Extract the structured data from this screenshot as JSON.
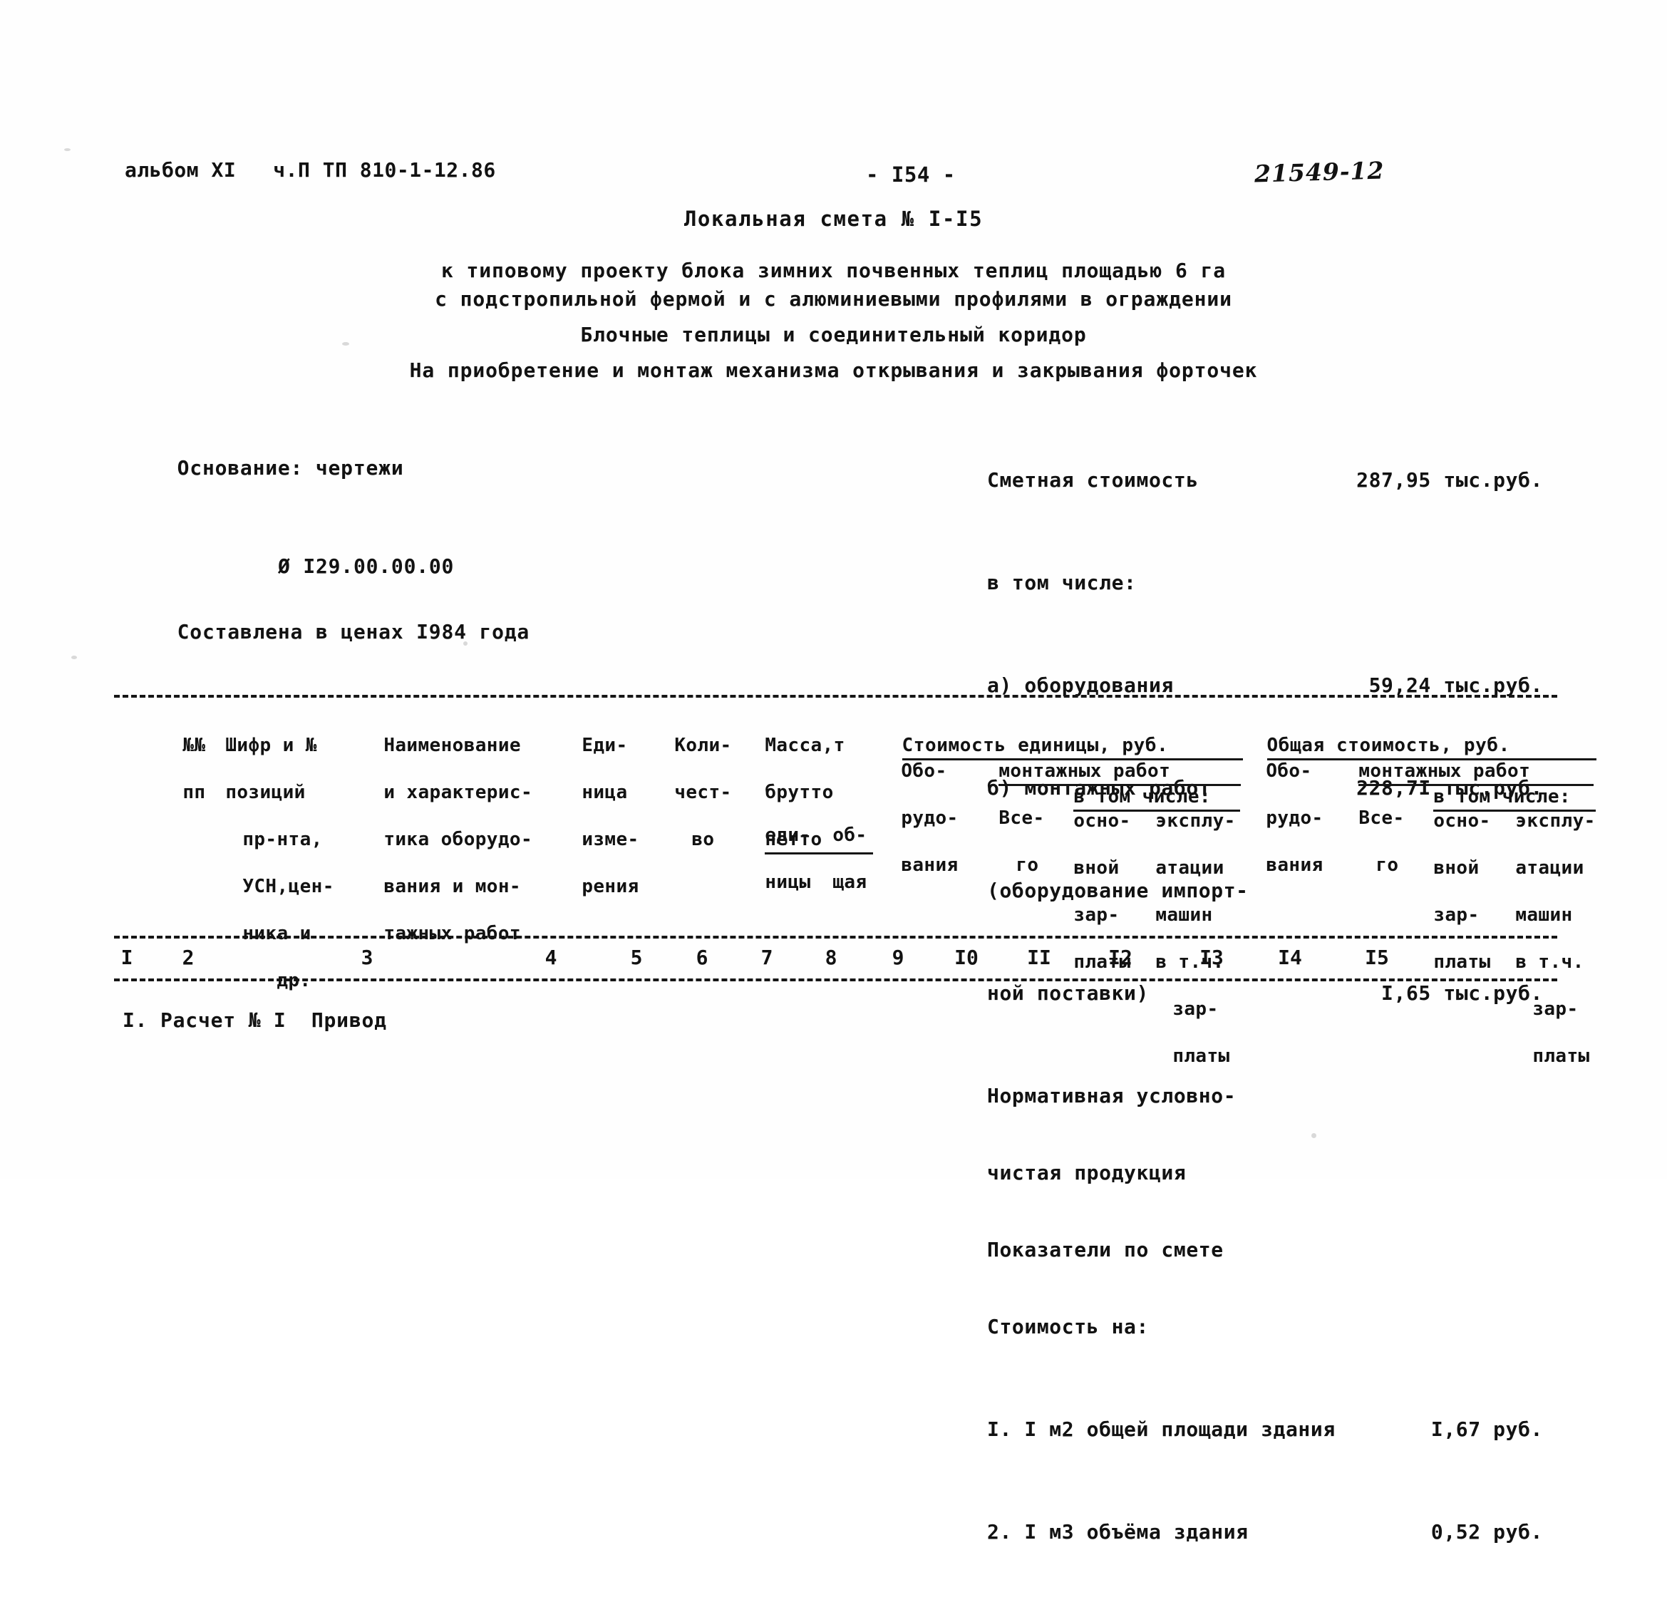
{
  "header": {
    "album": "альбом XI   ч.П ТП 810-1-12.86",
    "page_number": "- I54 -",
    "doc_code": "21549-12"
  },
  "title": {
    "main": "Локальная смета № I-I5",
    "line1": "к типовому проекту блока зимних почвенных теплиц площадью 6 га",
    "line2": "с подстропильной фермой и с алюминиевыми профилями в ограждении",
    "line3": "Блочные теплицы и соединительный коридор",
    "line4": "На приобретение и монтаж механизма открывания и закрывания форточек"
  },
  "basis": {
    "line1": "Основание: чертежи",
    "line2": "Ø I29.00.00.00",
    "line3": "Составлена в ценах I984 года"
  },
  "summary": {
    "total_label": "Сметная стоимость",
    "total_value": "287,95 тыс.руб.",
    "including_label": "в том числе:",
    "equipment_label": "а) оборудования",
    "equipment_value": "59,24 тыс.руб.",
    "installation_label": "б) монтажных работ",
    "installation_value": "228,7I тыс.руб.",
    "import_label1": "(оборудование импорт-",
    "import_label2": "ной поставки)",
    "import_value": "I,65 тыс.руб.",
    "nucp_line1": "Нормативная условно-",
    "nucp_line2": "чистая продукция",
    "indicators_label": "Показатели по смете",
    "cost_per_label": "Стоимость на:",
    "per_m2_label": "I. I м2 общей площади здания",
    "per_m2_value": "I,67 руб.",
    "per_m3_label": "2. I м3 объёма здания",
    "per_m3_value": "0,52 руб."
  },
  "table": {
    "columns": [
      {
        "num": "I",
        "lines": [
          "№№",
          "пп"
        ]
      },
      {
        "num": "2",
        "lines": [
          "Шифр и №",
          "позиций",
          "пр-нта,",
          "УСН,цен-",
          "ника и",
          "др."
        ]
      },
      {
        "num": "3",
        "lines": [
          "Наименование",
          "и характерис-",
          "тика оборудо-",
          "вания и мон-",
          "тажных работ"
        ]
      },
      {
        "num": "4",
        "lines": [
          "Еди-",
          "ница",
          "изме-",
          "рения"
        ]
      },
      {
        "num": "5",
        "lines": [
          "Коли-",
          "чест-",
          "во"
        ]
      },
      {
        "num": "6",
        "lines": [
          "еди-",
          "ницы"
        ]
      },
      {
        "num": "7",
        "lines": [
          "об-",
          "щая"
        ]
      },
      {
        "num": "8",
        "lines": [
          "Обо-",
          "рудо-",
          "вания"
        ]
      },
      {
        "num": "9",
        "lines": [
          "Все-",
          "го"
        ]
      },
      {
        "num": "I0",
        "lines": [
          "осно-",
          "вной",
          "зар-",
          "платы"
        ]
      },
      {
        "num": "II",
        "lines": [
          "эксплу-",
          "атации",
          "машин",
          "в т.ч.",
          "зар-",
          "платы"
        ]
      },
      {
        "num": "I2",
        "lines": [
          "Обо-",
          "рудо-",
          "вания"
        ]
      },
      {
        "num": "I3",
        "lines": [
          "Все-",
          "го"
        ]
      },
      {
        "num": "I4",
        "lines": [
          "осно-",
          "вной",
          "зар-",
          "платы"
        ]
      },
      {
        "num": "I5",
        "lines": [
          "эксплу-",
          "атации",
          "машин",
          "в т.ч.",
          "зар-",
          "платы"
        ]
      }
    ],
    "mass_group": {
      "title": "Масса,т",
      "brutto": "брутто",
      "netto": "нетто"
    },
    "unit_cost_group": {
      "title": "Стоимость единицы, руб.",
      "sub_installation": "монтажных работ",
      "sub_including": "в том числе:"
    },
    "total_cost_group": {
      "title": "Общая стоимость, руб.",
      "sub_installation": "монтажных работ",
      "sub_including": "в том числе:"
    }
  },
  "body": {
    "row1": "I. Расчет № I  Привод"
  },
  "colors": {
    "ink": "#121212",
    "paper": "#fefefe"
  }
}
